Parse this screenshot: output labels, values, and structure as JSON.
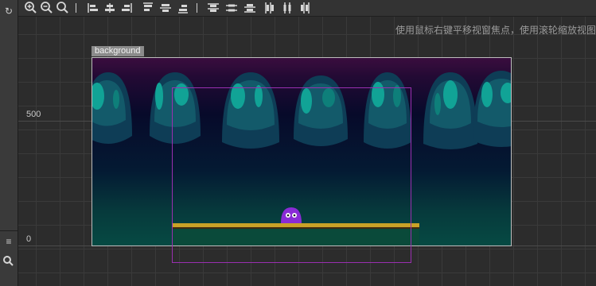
{
  "toolbar": {
    "buttons": [
      {
        "name": "zoom-in-icon"
      },
      {
        "name": "zoom-out-icon"
      },
      {
        "name": "zoom-reset-icon"
      },
      {
        "name": "align-left-icon"
      },
      {
        "name": "align-h-center-icon"
      },
      {
        "name": "align-right-icon"
      },
      {
        "name": "align-top-icon"
      },
      {
        "name": "align-v-center-icon"
      },
      {
        "name": "align-bottom-icon"
      },
      {
        "name": "distribute-top-icon"
      },
      {
        "name": "distribute-v-center-icon"
      },
      {
        "name": "distribute-bottom-icon"
      },
      {
        "name": "distribute-left-icon"
      },
      {
        "name": "distribute-h-center-icon"
      },
      {
        "name": "distribute-right-icon"
      }
    ]
  },
  "canvas": {
    "hint": "使用鼠标右键平移视窗焦点，使用滚轮缩放视图",
    "y_labels": [
      "500",
      "0"
    ]
  },
  "node": {
    "label": "background"
  },
  "sidebar": {
    "refresh_icon": "refresh-icon",
    "menu_icon": "menu-icon",
    "search_icon": "search-icon"
  },
  "colors": {
    "selection": "#9a2fb0",
    "character": "#8a2bd6",
    "platform": "#c9a227"
  }
}
